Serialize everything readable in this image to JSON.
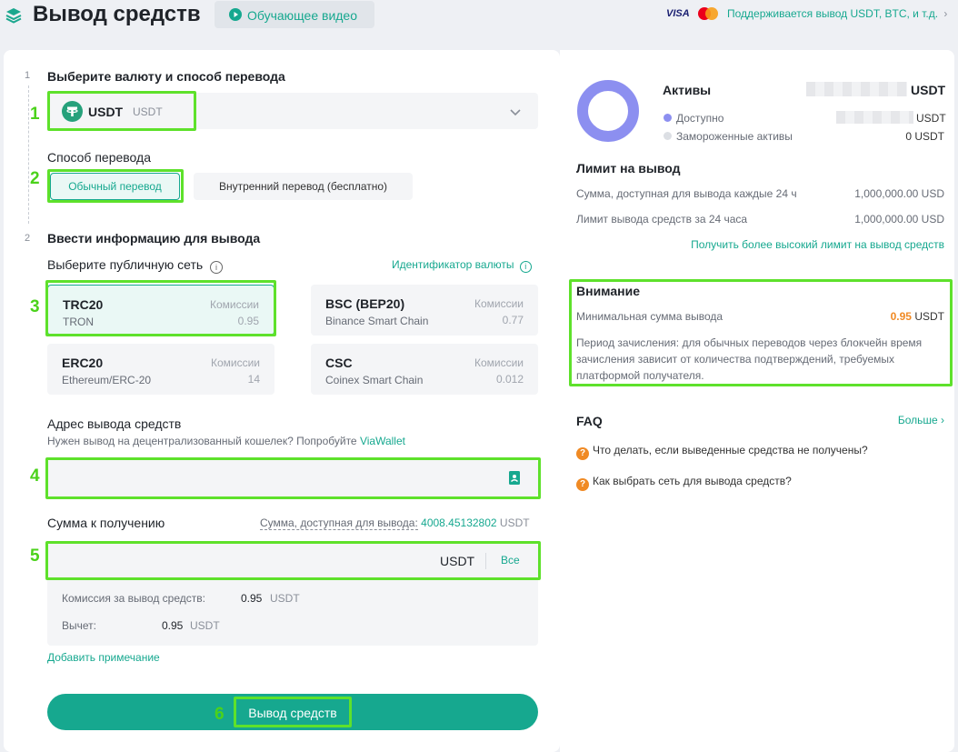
{
  "header": {
    "title": "Вывод средств",
    "tutorial_label": "Обучающее видео",
    "visa": "VISA",
    "supported_text": "Поддерживается вывод USDT, BTC, и т.д.",
    "supported_arrow": "›"
  },
  "steps": {
    "step1_num": "1",
    "step1_title": "Выберите валюту и способ перевода",
    "step2_num": "2",
    "step2_title": "Ввести информацию для вывода"
  },
  "annotations": [
    "1",
    "2",
    "3",
    "4",
    "5",
    "6"
  ],
  "currency": {
    "code": "USDT",
    "sub": "USDT"
  },
  "transfer": {
    "label": "Способ перевода",
    "normal": "Обычный перевод",
    "internal": "Внутренний перевод (бесплатно)"
  },
  "network": {
    "label": "Выберите публичную сеть",
    "currency_id_link": "Идентификатор валюты",
    "fee_label": "Комиссии",
    "items": [
      {
        "name": "TRC20",
        "sub": "TRON",
        "fee": "0.95"
      },
      {
        "name": "BSC (BEP20)",
        "sub": "Binance Smart Chain",
        "fee": "0.77"
      },
      {
        "name": "ERC20",
        "sub": "Ethereum/ERC-20",
        "fee": "14"
      },
      {
        "name": "CSC",
        "sub": "Coinex Smart Chain",
        "fee": "0.012"
      }
    ]
  },
  "address": {
    "label": "Адрес вывода средств",
    "hint": "Нужен вывод на децентрализованный кошелек? Попробуйте",
    "hint_link": "ViaWallet"
  },
  "amount": {
    "label": "Сумма к получению",
    "available_label": "Сумма, доступная для вывода:",
    "available_value": "4008.45132802",
    "available_unit": "USDT",
    "unit": "USDT",
    "all": "Все",
    "fee_label": "Комиссия за вывод средств:",
    "fee_value": "0.95",
    "fee_unit": "USDT",
    "deduction_label": "Вычет:",
    "deduction_value": "0.95",
    "deduction_unit": "USDT",
    "add_note": "Добавить примечание"
  },
  "submit_label": "Вывод средств",
  "assets": {
    "title": "Активы",
    "unit": "USDT",
    "available_label": "Доступно",
    "available_unit": "USDT",
    "frozen_label": "Замороженные активы",
    "frozen_value": "0 USDT"
  },
  "limits": {
    "title": "Лимит на вывод",
    "row1_label": "Сумма, доступная для вывода каждые 24 ч",
    "row1_value": "1,000,000.00 USD",
    "row2_label": "Лимит вывода средств за 24 часа",
    "row2_value": "1,000,000.00 USD",
    "link": "Получить более высокий лимит на вывод средств"
  },
  "notice": {
    "title": "Внимание",
    "min_label": "Минимальная сумма вывода",
    "min_value": "0.95",
    "min_unit": "USDT",
    "period_text": "Период зачисления: для обычных переводов через блокчейн время зачисления зависит от количества подтверждений, требуемых платформой получателя."
  },
  "faq": {
    "title": "FAQ",
    "more": "Больше",
    "more_arrow": "›",
    "q1": "Что делать, если выведенные средства не получены?",
    "q2": "Как выбрать сеть для вывода средств?"
  },
  "colors": {
    "accent": "#16a88f",
    "highlight": "#5ee12b",
    "orange": "#f08a24",
    "donut": "#8c8ff0"
  }
}
